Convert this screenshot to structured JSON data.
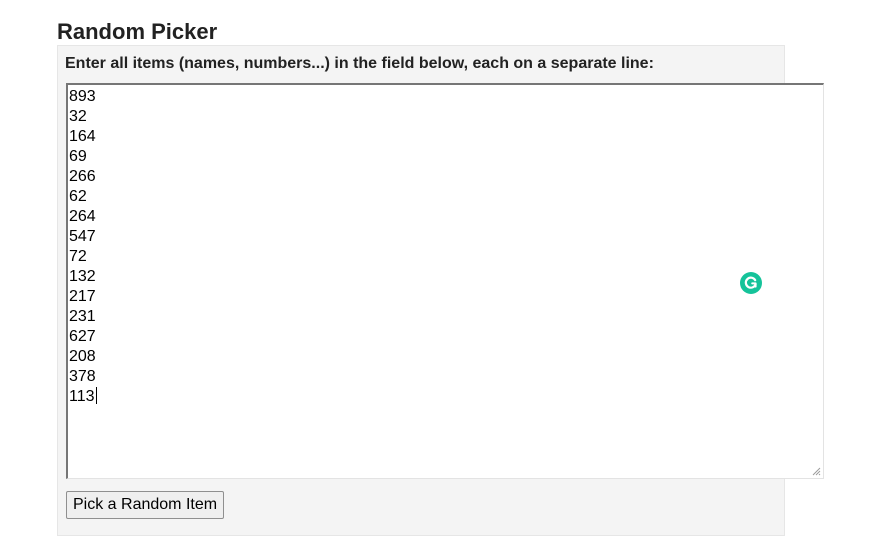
{
  "title": "Random Picker",
  "instructions": "Enter all items (names, numbers...) in the field below, each on a separate line:",
  "items": [
    "893",
    "32",
    "164",
    "69",
    "266",
    "62",
    "264",
    "547",
    "72",
    "132",
    "217",
    "231",
    "627",
    "208",
    "378",
    "113"
  ],
  "pick_button_label": "Pick a Random Item",
  "icons": {
    "grammarly": "grammarly-icon",
    "resize": "resize-grip-icon"
  },
  "colors": {
    "panel_background": "#f4f4f4",
    "grammarly_green": "#15c39a",
    "button_background": "#efefef"
  }
}
